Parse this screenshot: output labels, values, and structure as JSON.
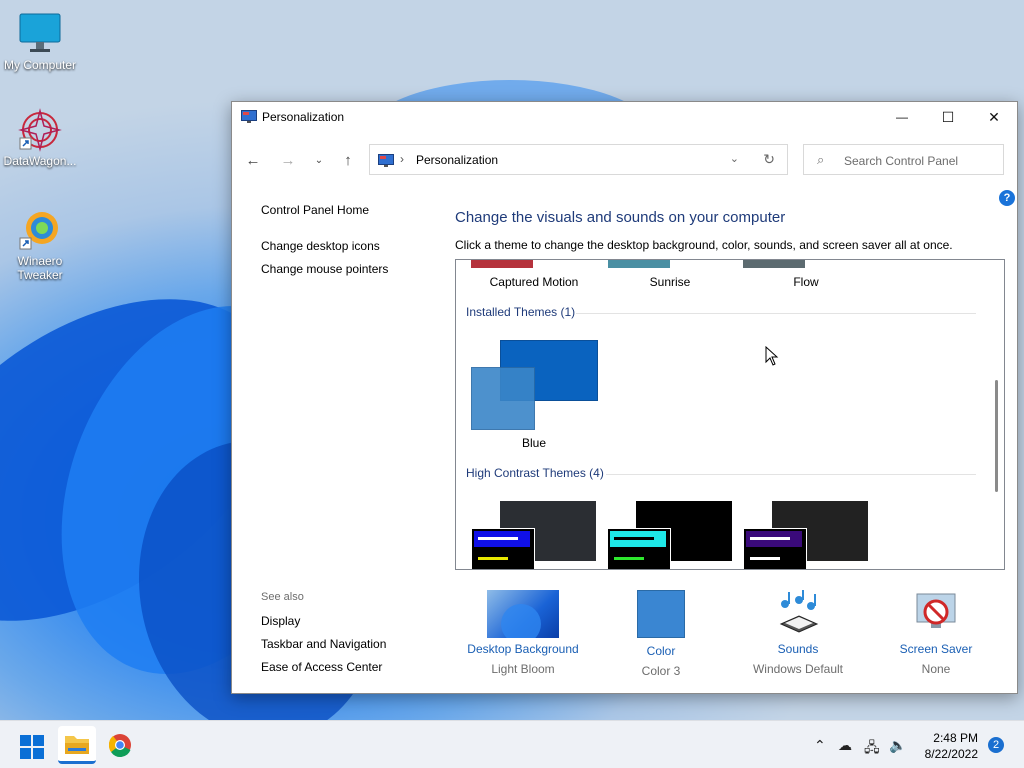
{
  "desktop": {
    "icons": [
      {
        "label": "My Computer"
      },
      {
        "label": "DataWagon..."
      },
      {
        "label": "Winaero Tweaker"
      }
    ]
  },
  "window": {
    "title": "Personalization",
    "controls": {
      "minimize": "—",
      "maximize": "☐",
      "close": "✕"
    }
  },
  "nav": {
    "breadcrumb_sep": "›",
    "breadcrumb": "Personalization",
    "search_placeholder": "Search Control Panel"
  },
  "left": {
    "links": [
      "Control Panel Home",
      "Change desktop icons",
      "Change mouse pointers"
    ],
    "see_also_title": "See also",
    "see_also": [
      "Display",
      "Taskbar and Navigation",
      "Ease of Access Center"
    ]
  },
  "main": {
    "heading": "Change the visuals and sounds on your computer",
    "subheading": "Click a theme to change the desktop background, color, sounds, and screen saver all at once.",
    "top_themes": [
      "Captured Motion",
      "Sunrise",
      "Flow"
    ],
    "installed_group": "Installed Themes (1)",
    "installed_theme": "Blue",
    "high_contrast_group": "High Contrast Themes (4)"
  },
  "bottom": [
    {
      "label": "Desktop Background",
      "sub": "Light Bloom"
    },
    {
      "label": "Color",
      "sub": "Color 3"
    },
    {
      "label": "Sounds",
      "sub": "Windows Default"
    },
    {
      "label": "Screen Saver",
      "sub": "None"
    }
  ],
  "taskbar": {
    "time": "2:48 PM",
    "date": "8/22/2022",
    "notifications": "2"
  },
  "colors": {
    "accent": "#1a5fb4",
    "heading": "#1f3b7a",
    "blue_theme": "#0a63bf"
  }
}
